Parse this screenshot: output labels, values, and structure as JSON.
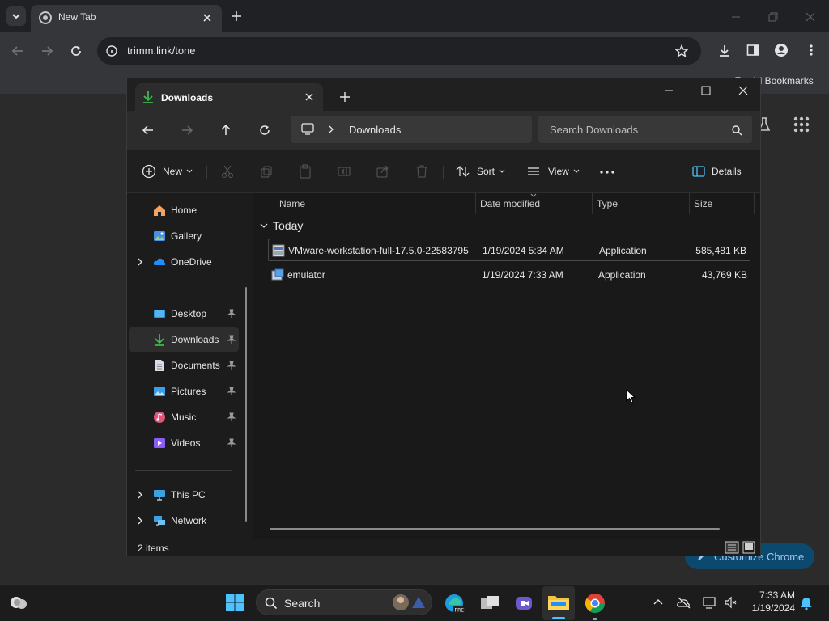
{
  "browser": {
    "tab_title": "New Tab",
    "url": "trimm.link/tone",
    "bookmarks_label": "All Bookmarks",
    "customize_label": "Customize Chrome"
  },
  "explorer": {
    "tab_title": "Downloads",
    "breadcrumb": "Downloads",
    "search_placeholder": "Search Downloads",
    "commands": {
      "new": "New",
      "sort": "Sort",
      "view": "View",
      "details": "Details"
    },
    "sidebar": {
      "top": [
        {
          "label": "Home",
          "icon": "home-icon"
        },
        {
          "label": "Gallery",
          "icon": "gallery-icon"
        },
        {
          "label": "OneDrive",
          "icon": "onedrive-icon"
        }
      ],
      "pinned": [
        {
          "label": "Desktop",
          "icon": "desktop-folder-icon"
        },
        {
          "label": "Downloads",
          "icon": "downloads-folder-icon"
        },
        {
          "label": "Documents",
          "icon": "documents-folder-icon"
        },
        {
          "label": "Pictures",
          "icon": "pictures-folder-icon"
        },
        {
          "label": "Music",
          "icon": "music-folder-icon"
        },
        {
          "label": "Videos",
          "icon": "videos-folder-icon"
        }
      ],
      "bottom": [
        {
          "label": "This PC",
          "icon": "this-pc-icon"
        },
        {
          "label": "Network",
          "icon": "network-icon"
        }
      ]
    },
    "columns": {
      "name": "Name",
      "date": "Date modified",
      "type": "Type",
      "size": "Size"
    },
    "group_label": "Today",
    "files": [
      {
        "name": "VMware-workstation-full-17.5.0-22583795",
        "date": "1/19/2024 5:34 AM",
        "type": "Application",
        "size": "585,481 KB"
      },
      {
        "name": "emulator",
        "date": "1/19/2024 7:33 AM",
        "type": "Application",
        "size": "43,769 KB"
      }
    ],
    "status": "2 items"
  },
  "taskbar": {
    "search_label": "Search",
    "time": "7:33 AM",
    "date": "1/19/2024"
  },
  "colors": {
    "accent": "#4cc2ff",
    "selection": "#2d2d2d",
    "download_green": "#3fb950"
  }
}
